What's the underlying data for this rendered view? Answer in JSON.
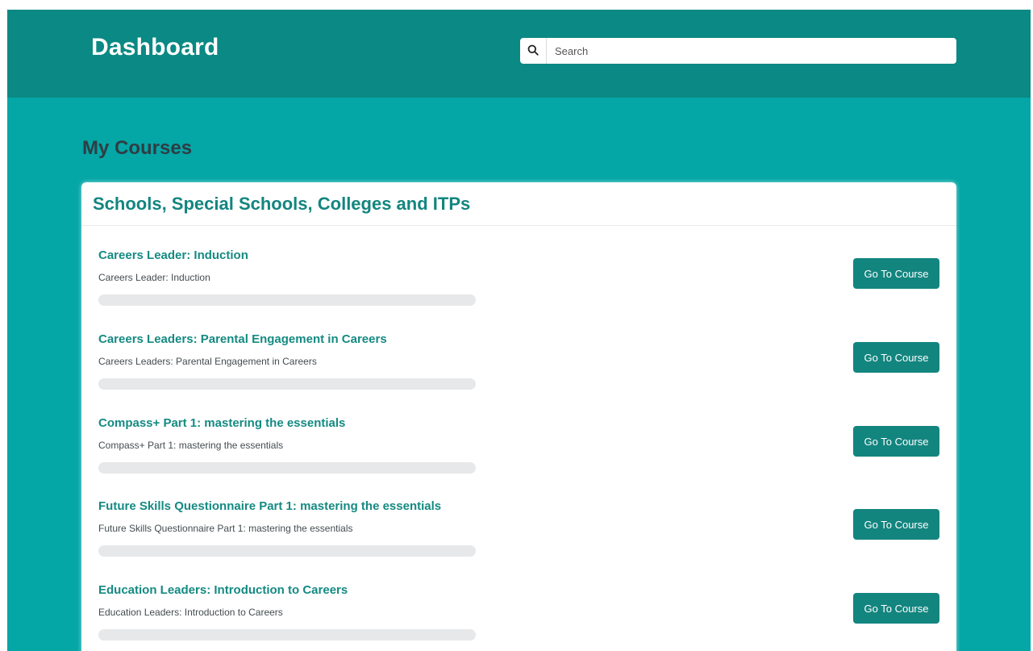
{
  "header": {
    "title": "Dashboard",
    "search": {
      "placeholder": "Search",
      "value": ""
    }
  },
  "main": {
    "section_title": "My Courses",
    "card": {
      "title": "Schools, Special Schools, Colleges and ITPs",
      "courses": [
        {
          "name": "Careers Leader: Induction",
          "description": "Careers Leader: Induction",
          "progress": 0,
          "button_label": "Go To Course"
        },
        {
          "name": "Careers Leaders: Parental Engagement in Careers",
          "description": "Careers Leaders: Parental Engagement in Careers",
          "progress": 0,
          "button_label": "Go To Course"
        },
        {
          "name": "Compass+ Part 1: mastering the essentials",
          "description": "Compass+ Part 1: mastering the essentials",
          "progress": 0,
          "button_label": "Go To Course"
        },
        {
          "name": "Future Skills Questionnaire Part 1: mastering the essentials",
          "description": "Future Skills Questionnaire Part 1: mastering the essentials",
          "progress": 0,
          "button_label": "Go To Course"
        },
        {
          "name": "Education Leaders: Introduction to Careers",
          "description": "Education Leaders: Introduction to Careers",
          "progress": 0,
          "button_label": "Go To Course"
        }
      ]
    }
  },
  "colors": {
    "header_bg": "#0b8984",
    "page_bg": "#04a6a6",
    "accent": "#13857f",
    "progress_track": "#e6e8ea"
  },
  "icons": {
    "search": "search-icon"
  }
}
